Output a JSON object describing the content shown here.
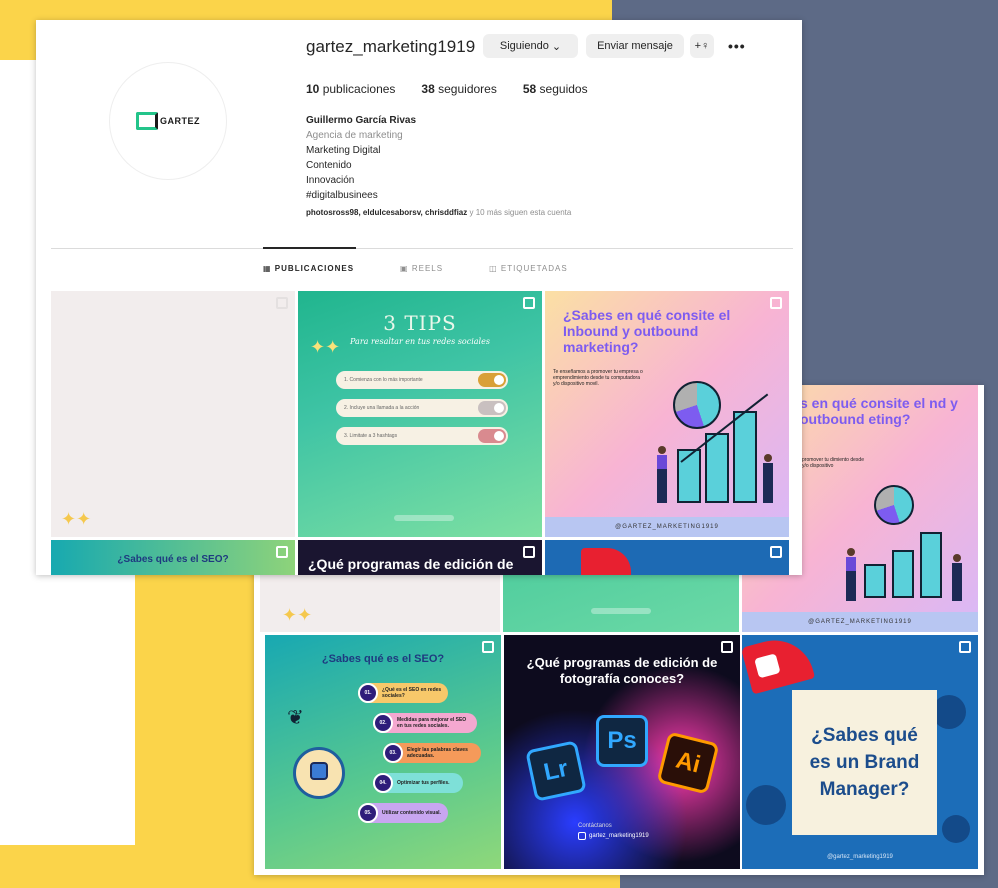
{
  "profile": {
    "username": "gartez_marketing1919",
    "buttons": {
      "following": "Siguiendo",
      "message": "Enviar mensaje",
      "add_user": "+♀",
      "more": "•••"
    },
    "stats": {
      "posts_count": "10",
      "posts_label": "publicaciones",
      "followers_count": "38",
      "followers_label": "seguidores",
      "following_count": "58",
      "following_label": "seguidos"
    },
    "bio": {
      "name": "Guillermo García Rivas",
      "category": "Agencia de marketing",
      "lines": [
        "Marketing Digital",
        "Contenido",
        "Innovación",
        "#digitalbusinees"
      ]
    },
    "followed_by": {
      "accounts": "photosross98, eldulcesaborsv, chrisddfiaz",
      "rest": "y 10 más siguen esta cuenta"
    },
    "tabs": [
      "PUBLICACIONES",
      "REELS",
      "ETIQUETADAS"
    ],
    "logo_text": "GARTEZ"
  },
  "posts": {
    "tips": {
      "title": "3 TIPS",
      "subtitle": "Para resaltar en tus redes sociales",
      "items": [
        "1. Comienza con lo más importante",
        "2. Incluye una llamada a la acción",
        "3. Limitate a 3 hashtags"
      ],
      "toggle_colors": [
        "#d9a037",
        "#c9c0c0",
        "#d98a8f"
      ]
    },
    "inbound": {
      "title": "¿Sabes en qué consite el Inbound y outbound marketing?",
      "title_cropped": "s en qué consite el nd y outbound eting?",
      "text": "Te enseñamos a promover tu empresa o emprendimiento desde tu computadora y/o dispositivo movil.",
      "text_cropped": "promover tu dimiento desde y/o dispositivo",
      "footer": "@GARTEZ_MARKETING1919",
      "footer_back": "@GARTEZ_MARKETING1919"
    },
    "seo": {
      "title": "¿Sabes qué es el SEO?",
      "items": [
        {
          "num": "01.",
          "text": "¿Qué es el SEO en redes sociales?",
          "color": "#f7c86a"
        },
        {
          "num": "02.",
          "text": "Medidas para mejorar el SEO en tus redes sociales.",
          "color": "#f4a8d0"
        },
        {
          "num": "03.",
          "text": "Elegir las palabras claves adecuadas.",
          "color": "#f59a5a"
        },
        {
          "num": "04.",
          "text": "Optimizar tus perfiles.",
          "color": "#7ee0d8"
        },
        {
          "num": "05.",
          "text": "Utilizar contenido visual.",
          "color": "#c8a6f0"
        }
      ]
    },
    "programs": {
      "title": "¿Qué programas de edición de fotografía conoces?",
      "title_cropped": "¿Qué programas de edición de",
      "apps": [
        "Lr",
        "Ps",
        "Ai"
      ],
      "contact_label": "Contáctanos",
      "handle": "gartez_marketing1919"
    },
    "brand": {
      "title": "¿Sabes qué es un Brand Manager?",
      "handle": "@gartez_marketing1919"
    }
  },
  "colors": {
    "yellow": "#fbd44a",
    "slate": "#5d6a86",
    "accent_purple": "#7d5cf0",
    "brand_blue": "#1c6db8"
  }
}
